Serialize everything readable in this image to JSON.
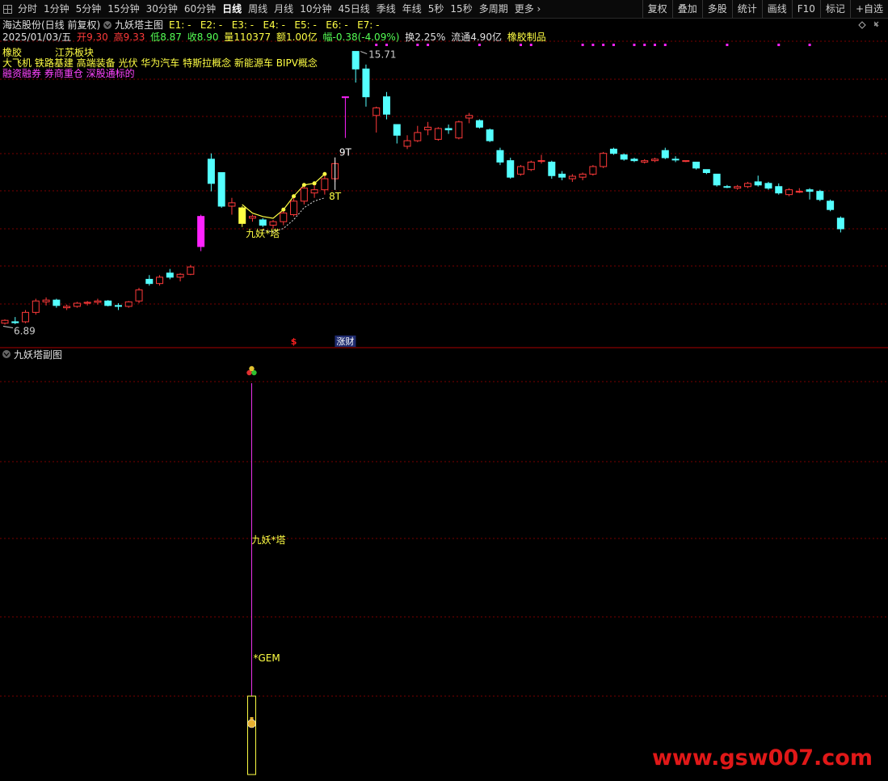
{
  "toolbar": {
    "periods": [
      {
        "label": "分时",
        "active": false
      },
      {
        "label": "1分钟",
        "active": false
      },
      {
        "label": "5分钟",
        "active": false
      },
      {
        "label": "15分钟",
        "active": false
      },
      {
        "label": "30分钟",
        "active": false
      },
      {
        "label": "60分钟",
        "active": false
      },
      {
        "label": "日线",
        "active": true
      },
      {
        "label": "周线",
        "active": false
      },
      {
        "label": "月线",
        "active": false
      },
      {
        "label": "10分钟",
        "active": false
      },
      {
        "label": "45日线",
        "active": false
      },
      {
        "label": "季线",
        "active": false
      },
      {
        "label": "年线",
        "active": false
      },
      {
        "label": "5秒",
        "active": false
      },
      {
        "label": "15秒",
        "active": false
      },
      {
        "label": "多周期",
        "active": false
      },
      {
        "label": "更多",
        "active": false
      }
    ],
    "right_buttons": [
      "复权",
      "叠加",
      "多股",
      "统计",
      "画线",
      "F10",
      "标记",
      "+自选"
    ]
  },
  "main_header": {
    "stock": "海达股份(日线 前复权)",
    "indicator": "九妖塔主图",
    "params": "E1: -   E2: -   E3: -   E4: -   E5: -   E6: -   E7: -",
    "date": "2025/01/03/五",
    "open_label": "开",
    "open": "9.30",
    "high_label": "高",
    "high": "9.33",
    "low_label": "低",
    "low": "8.87",
    "close_label": "收",
    "close": "8.90",
    "volume_label": "量",
    "volume": "110377",
    "amount_label": "额",
    "amount": "1.00亿",
    "change_label": "幅",
    "change": "-0.38(-4.09%)",
    "turnover_label": "换",
    "turnover": "2.25%",
    "float_label": "流通",
    "float_cap": "4.90亿",
    "industry": "橡胶制品",
    "tag1": "橡胶",
    "tag2": "江苏板块",
    "concepts": "大飞机 铁路基建 高端装备 光伏 华为汽车 特斯拉概念 新能源车 BIPV概念",
    "margin": "融资融券 券商重仓 深股通标的"
  },
  "sub_header": {
    "title": "九妖塔副图"
  },
  "colors": {
    "up": "#ff3a3a",
    "down": "#54ffff",
    "magenta": "#ff22ff",
    "yellow": "#ffff44",
    "grid": "#7a0000"
  },
  "chart_data": {
    "type": "candlestick",
    "y_scale": "log",
    "ylim": [
      6.7,
      16.2
    ],
    "max_label": "15.71",
    "min_label": "6.89",
    "annotations": [
      {
        "text": "9T",
        "color": "#ffffff"
      },
      {
        "text": "8T",
        "color": "#ffff44"
      },
      {
        "text": "九妖*塔",
        "color": "#ffff44"
      }
    ],
    "markers": [
      {
        "text": "$",
        "color": "#ff2020"
      },
      {
        "text": "涨财",
        "color": "#ffffff"
      }
    ],
    "sub_annotations": [
      "九妖*塔",
      "*GEM"
    ],
    "candles": [
      {
        "o": 6.92,
        "h": 7.0,
        "l": 6.89,
        "c": 6.98
      },
      {
        "o": 6.95,
        "h": 7.05,
        "l": 6.9,
        "c": 6.93
      },
      {
        "o": 6.95,
        "h": 7.2,
        "l": 6.92,
        "c": 7.15
      },
      {
        "o": 7.15,
        "h": 7.45,
        "l": 7.1,
        "c": 7.4
      },
      {
        "o": 7.38,
        "h": 7.48,
        "l": 7.3,
        "c": 7.42
      },
      {
        "o": 7.42,
        "h": 7.45,
        "l": 7.25,
        "c": 7.3
      },
      {
        "o": 7.25,
        "h": 7.32,
        "l": 7.2,
        "c": 7.28
      },
      {
        "o": 7.28,
        "h": 7.38,
        "l": 7.25,
        "c": 7.35
      },
      {
        "o": 7.35,
        "h": 7.4,
        "l": 7.3,
        "c": 7.37
      },
      {
        "o": 7.37,
        "h": 7.45,
        "l": 7.32,
        "c": 7.4
      },
      {
        "o": 7.4,
        "h": 7.42,
        "l": 7.28,
        "c": 7.3
      },
      {
        "o": 7.3,
        "h": 7.35,
        "l": 7.2,
        "c": 7.28
      },
      {
        "o": 7.28,
        "h": 7.4,
        "l": 7.25,
        "c": 7.38
      },
      {
        "o": 7.4,
        "h": 7.7,
        "l": 7.35,
        "c": 7.65
      },
      {
        "o": 7.9,
        "h": 8.0,
        "l": 7.75,
        "c": 7.8
      },
      {
        "o": 7.8,
        "h": 8.0,
        "l": 7.75,
        "c": 7.95
      },
      {
        "o": 8.05,
        "h": 8.15,
        "l": 7.9,
        "c": 7.95
      },
      {
        "o": 7.95,
        "h": 8.05,
        "l": 7.85,
        "c": 8.02
      },
      {
        "o": 8.02,
        "h": 8.25,
        "l": 8.0,
        "c": 8.2
      },
      {
        "o": 8.72,
        "h": 9.6,
        "l": 8.6,
        "c": 9.55
      },
      {
        "o": 11.35,
        "h": 11.55,
        "l": 10.3,
        "c": 10.55
      },
      {
        "o": 10.9,
        "h": 10.9,
        "l": 9.8,
        "c": 9.85
      },
      {
        "o": 9.85,
        "h": 10.1,
        "l": 9.6,
        "c": 9.95
      },
      {
        "o": 9.8,
        "h": 9.85,
        "l": 9.25,
        "c": 9.35
      },
      {
        "o": 9.5,
        "h": 9.6,
        "l": 9.4,
        "c": 9.55
      },
      {
        "o": 9.45,
        "h": 9.5,
        "l": 9.25,
        "c": 9.3
      },
      {
        "o": 9.3,
        "h": 9.45,
        "l": 9.2,
        "c": 9.4
      },
      {
        "o": 9.4,
        "h": 9.7,
        "l": 9.3,
        "c": 9.65
      },
      {
        "o": 9.6,
        "h": 10.1,
        "l": 9.55,
        "c": 10.0
      },
      {
        "o": 10.0,
        "h": 10.45,
        "l": 9.9,
        "c": 10.4
      },
      {
        "o": 10.25,
        "h": 10.5,
        "l": 10.1,
        "c": 10.35
      },
      {
        "o": 10.35,
        "h": 10.8,
        "l": 10.2,
        "c": 10.7
      },
      {
        "o": 10.7,
        "h": 11.3,
        "l": 10.6,
        "c": 11.2
      },
      {
        "o": 13.7,
        "h": 13.7,
        "l": 12.1,
        "c": 13.7
      },
      {
        "o": 15.71,
        "h": 15.71,
        "l": 14.3,
        "c": 14.9
      },
      {
        "o": 14.9,
        "h": 15.1,
        "l": 13.3,
        "c": 13.7
      },
      {
        "o": 12.95,
        "h": 13.3,
        "l": 12.3,
        "c": 13.25
      },
      {
        "o": 13.7,
        "h": 13.9,
        "l": 12.8,
        "c": 13.0
      },
      {
        "o": 12.6,
        "h": 12.6,
        "l": 11.9,
        "c": 12.2
      },
      {
        "o": 11.8,
        "h": 12.2,
        "l": 11.7,
        "c": 12.0
      },
      {
        "o": 12.0,
        "h": 12.55,
        "l": 11.95,
        "c": 12.3
      },
      {
        "o": 12.4,
        "h": 12.7,
        "l": 12.2,
        "c": 12.5
      },
      {
        "o": 12.05,
        "h": 12.5,
        "l": 12.0,
        "c": 12.45
      },
      {
        "o": 12.45,
        "h": 12.6,
        "l": 12.25,
        "c": 12.4
      },
      {
        "o": 12.1,
        "h": 12.75,
        "l": 12.05,
        "c": 12.7
      },
      {
        "o": 12.85,
        "h": 13.05,
        "l": 12.65,
        "c": 12.95
      },
      {
        "o": 12.75,
        "h": 12.8,
        "l": 12.45,
        "c": 12.5
      },
      {
        "o": 12.4,
        "h": 12.45,
        "l": 11.95,
        "c": 12.0
      },
      {
        "o": 11.65,
        "h": 11.75,
        "l": 11.15,
        "c": 11.25
      },
      {
        "o": 11.3,
        "h": 11.4,
        "l": 10.7,
        "c": 10.75
      },
      {
        "o": 10.85,
        "h": 11.15,
        "l": 10.8,
        "c": 11.1
      },
      {
        "o": 11.0,
        "h": 11.3,
        "l": 10.95,
        "c": 11.25
      },
      {
        "o": 11.3,
        "h": 11.5,
        "l": 11.2,
        "c": 11.3
      },
      {
        "o": 11.25,
        "h": 11.3,
        "l": 10.7,
        "c": 10.8
      },
      {
        "o": 10.85,
        "h": 10.95,
        "l": 10.65,
        "c": 10.75
      },
      {
        "o": 10.7,
        "h": 10.85,
        "l": 10.6,
        "c": 10.78
      },
      {
        "o": 10.75,
        "h": 10.9,
        "l": 10.65,
        "c": 10.85
      },
      {
        "o": 10.85,
        "h": 11.15,
        "l": 10.8,
        "c": 11.1
      },
      {
        "o": 11.1,
        "h": 11.6,
        "l": 11.05,
        "c": 11.55
      },
      {
        "o": 11.7,
        "h": 11.75,
        "l": 11.5,
        "c": 11.55
      },
      {
        "o": 11.5,
        "h": 11.55,
        "l": 11.3,
        "c": 11.35
      },
      {
        "o": 11.35,
        "h": 11.4,
        "l": 11.25,
        "c": 11.3
      },
      {
        "o": 11.25,
        "h": 11.35,
        "l": 11.2,
        "c": 11.3
      },
      {
        "o": 11.3,
        "h": 11.4,
        "l": 11.25,
        "c": 11.35
      },
      {
        "o": 11.65,
        "h": 11.75,
        "l": 11.35,
        "c": 11.4
      },
      {
        "o": 11.35,
        "h": 11.45,
        "l": 11.25,
        "c": 11.33
      },
      {
        "o": 11.3,
        "h": 11.3,
        "l": 11.25,
        "c": 11.3
      },
      {
        "o": 11.25,
        "h": 11.25,
        "l": 11.0,
        "c": 11.05
      },
      {
        "o": 11.0,
        "h": 11.0,
        "l": 10.85,
        "c": 10.9
      },
      {
        "o": 10.85,
        "h": 10.85,
        "l": 10.45,
        "c": 10.5
      },
      {
        "o": 10.45,
        "h": 10.5,
        "l": 10.4,
        "c": 10.44
      },
      {
        "o": 10.4,
        "h": 10.5,
        "l": 10.35,
        "c": 10.45
      },
      {
        "o": 10.45,
        "h": 10.6,
        "l": 10.4,
        "c": 10.55
      },
      {
        "o": 10.6,
        "h": 10.8,
        "l": 10.45,
        "c": 10.5
      },
      {
        "o": 10.55,
        "h": 10.6,
        "l": 10.35,
        "c": 10.4
      },
      {
        "o": 10.45,
        "h": 10.55,
        "l": 10.2,
        "c": 10.25
      },
      {
        "o": 10.2,
        "h": 10.4,
        "l": 10.15,
        "c": 10.35
      },
      {
        "o": 10.3,
        "h": 10.4,
        "l": 10.25,
        "c": 10.3
      },
      {
        "o": 10.35,
        "h": 10.4,
        "l": 10.05,
        "c": 10.3
      },
      {
        "o": 10.3,
        "h": 10.35,
        "l": 10.0,
        "c": 10.05
      },
      {
        "o": 10.0,
        "h": 10.05,
        "l": 9.7,
        "c": 9.75
      },
      {
        "o": 9.5,
        "h": 9.55,
        "l": 9.1,
        "c": 9.2
      }
    ]
  }
}
